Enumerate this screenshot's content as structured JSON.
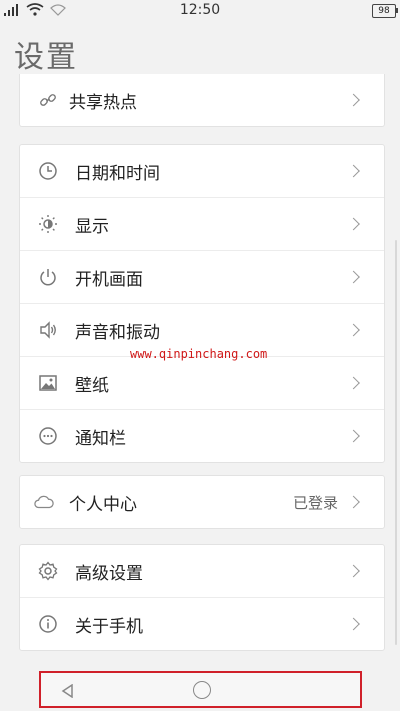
{
  "status_bar": {
    "time": "12:50",
    "battery": "98"
  },
  "page_title": "设置",
  "groups": [
    {
      "items": [
        {
          "label": "共享热点",
          "icon": "link-icon"
        }
      ]
    },
    {
      "items": [
        {
          "label": "日期和时间",
          "icon": "clock-icon"
        },
        {
          "label": "显示",
          "icon": "brightness-icon"
        },
        {
          "label": "开机画面",
          "icon": "power-icon"
        },
        {
          "label": "声音和振动",
          "icon": "speaker-icon"
        },
        {
          "label": "壁纸",
          "icon": "image-icon"
        },
        {
          "label": "通知栏",
          "icon": "more-dots-icon"
        }
      ]
    },
    {
      "items": [
        {
          "label": "个人中心",
          "icon": "cloud-icon",
          "value": "已登录"
        }
      ]
    },
    {
      "items": [
        {
          "label": "高级设置",
          "icon": "gear-icon"
        },
        {
          "label": "关于手机",
          "icon": "info-icon"
        }
      ]
    }
  ],
  "watermark": "www.qinpinchang.com",
  "colors": {
    "highlight_border": "#d0202a",
    "watermark": "#d01818"
  }
}
